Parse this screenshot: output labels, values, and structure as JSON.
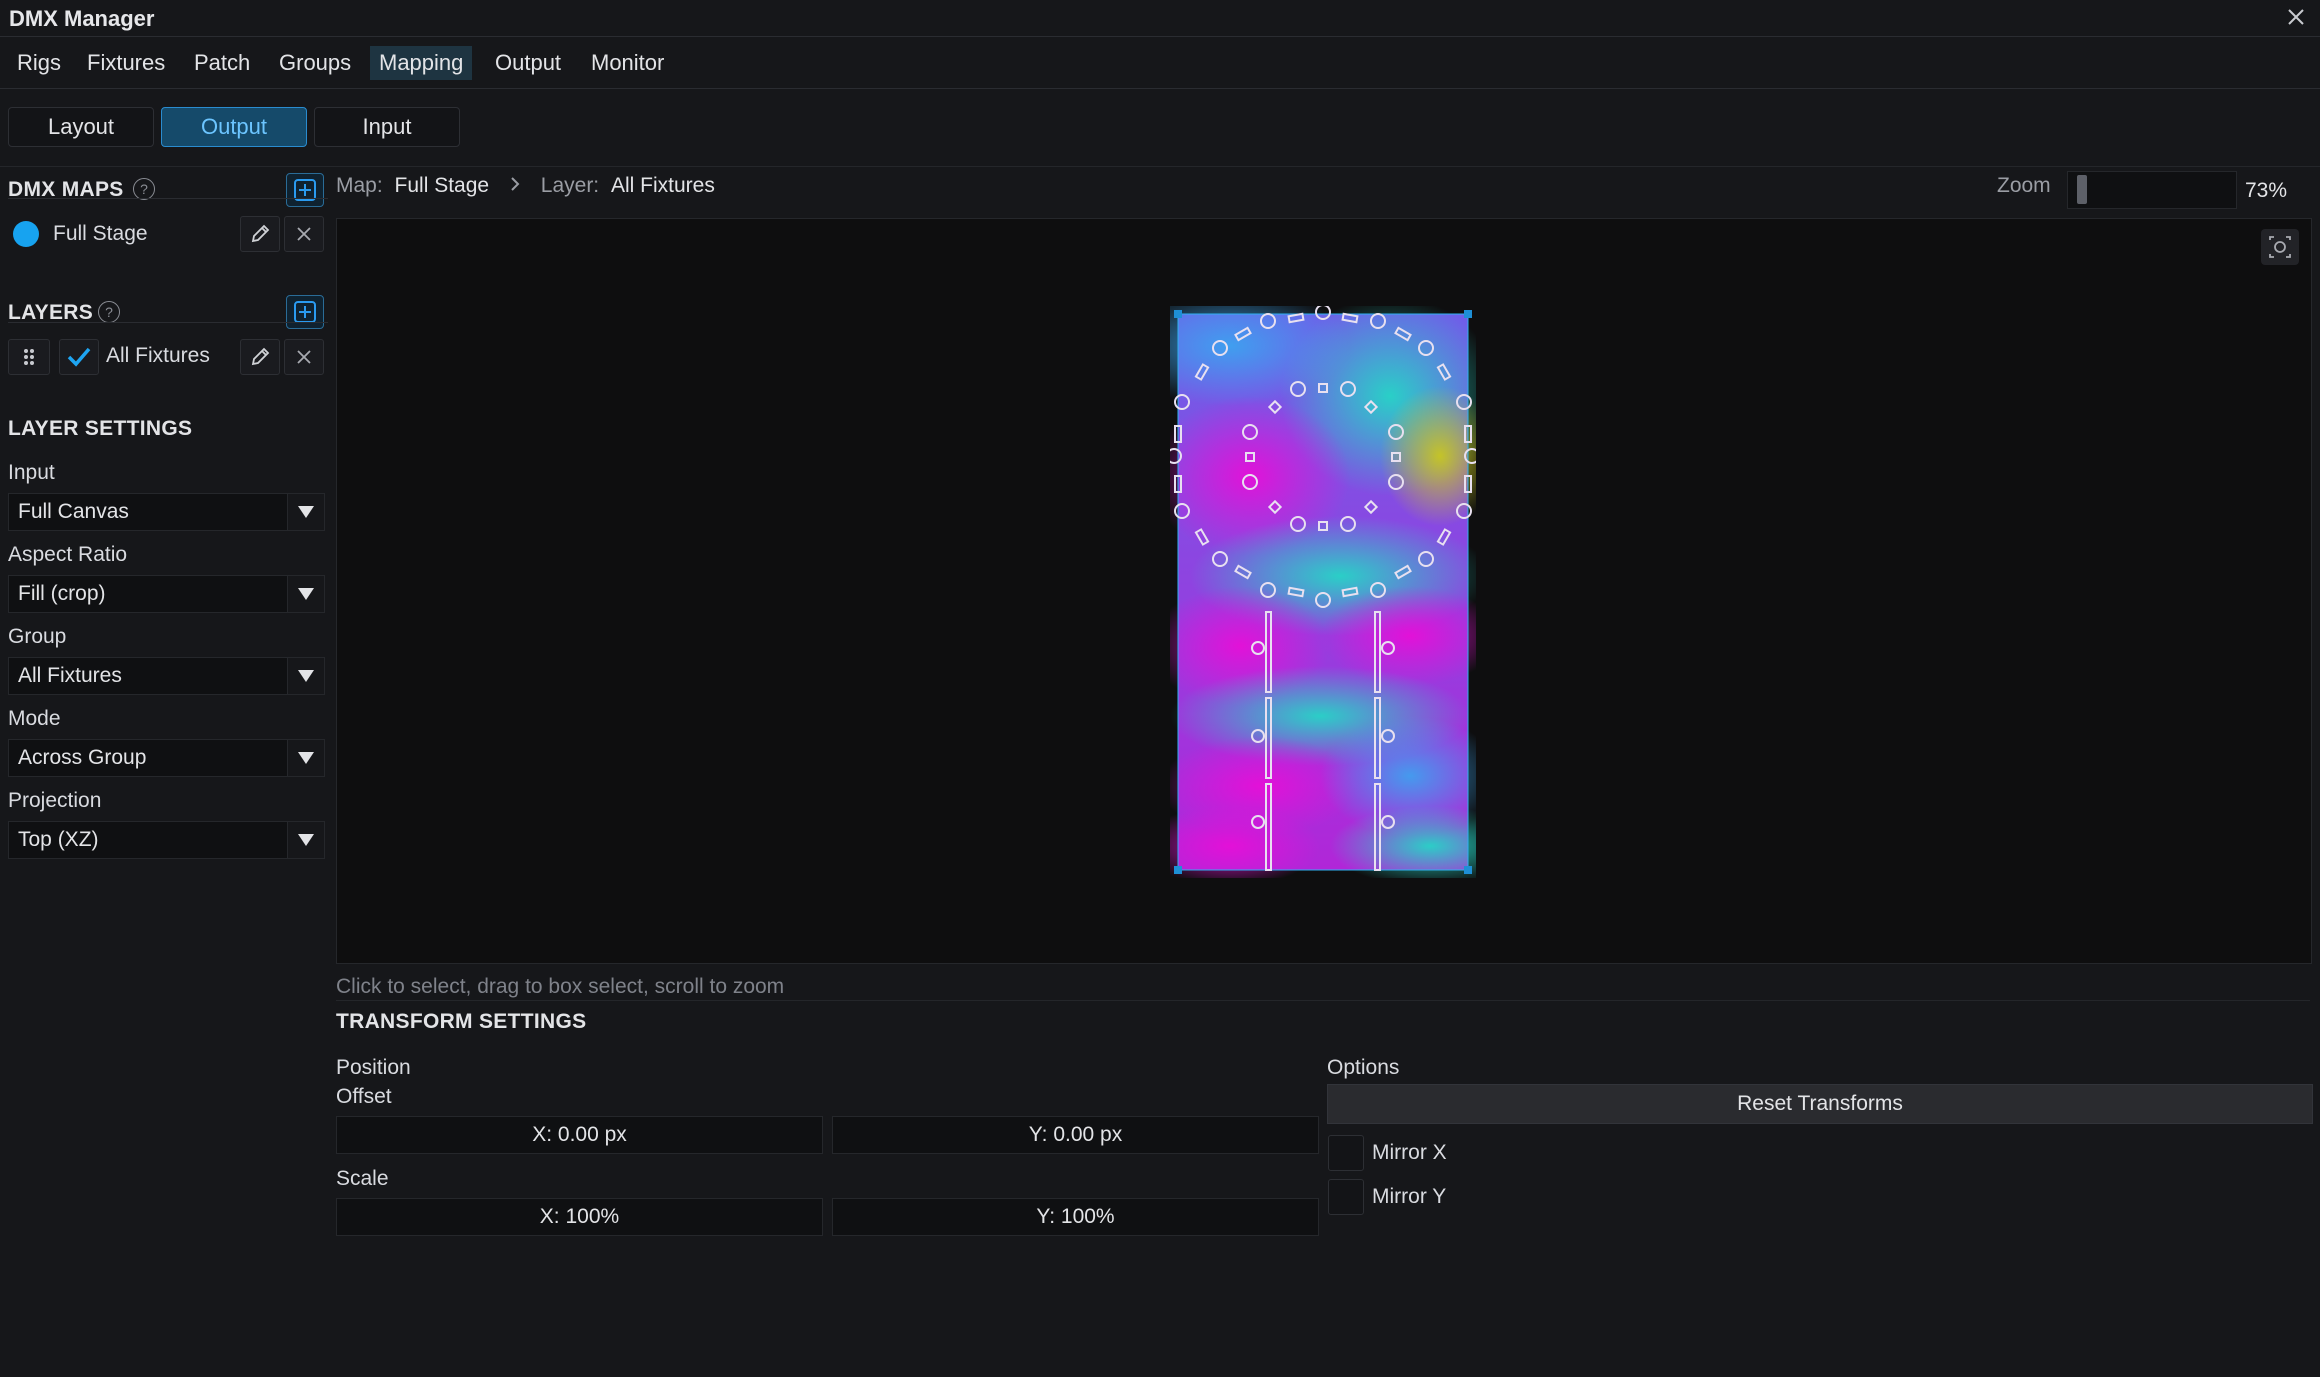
{
  "window": {
    "title": "DMX Manager"
  },
  "menu": [
    "Rigs",
    "Fixtures",
    "Patch",
    "Groups",
    "Mapping",
    "Output",
    "Monitor"
  ],
  "menu_active": "Mapping",
  "modes": {
    "layout": "Layout",
    "output": "Output",
    "input": "Input",
    "active": "Output"
  },
  "dmx_maps": {
    "title": "DMX MAPS",
    "items": [
      {
        "name": "Full Stage",
        "color": "#17a3f0"
      }
    ]
  },
  "layers": {
    "title": "LAYERS",
    "items": [
      {
        "name": "All Fixtures",
        "checked": true
      }
    ]
  },
  "layer_settings": {
    "title": "LAYER SETTINGS",
    "input_label": "Input",
    "input_value": "Full Canvas",
    "aspect_label": "Aspect Ratio",
    "aspect_value": "Fill (crop)",
    "group_label": "Group",
    "group_value": "All Fixtures",
    "mode_label": "Mode",
    "mode_value": "Across Group",
    "projection_label": "Projection",
    "projection_value": "Top (XZ)"
  },
  "breadcrumb": {
    "map_label": "Map:",
    "map_value": "Full Stage",
    "layer_label": "Layer:",
    "layer_value": "All Fixtures"
  },
  "zoom": {
    "label": "Zoom",
    "value": "73%",
    "level": 0.73
  },
  "hint": "Click to select, drag to box select, scroll to zoom",
  "transform": {
    "title": "TRANSFORM SETTINGS",
    "position_label": "Position",
    "offset_label": "Offset",
    "offset_x": "X: 0.00 px",
    "offset_y": "Y: 0.00 px",
    "scale_label": "Scale",
    "scale_x": "X: 100%",
    "scale_y": "Y: 100%",
    "options_label": "Options",
    "reset_label": "Reset Transforms",
    "mirror_x": "Mirror X",
    "mirror_y": "Mirror Y"
  },
  "colors": {
    "accent": "#17a3f0",
    "bg": "#16171a",
    "canvas_bg": "#0e0e0f",
    "fixture_magenta": "#e12ae6",
    "fixture_cyan": "#3ee0e0"
  }
}
